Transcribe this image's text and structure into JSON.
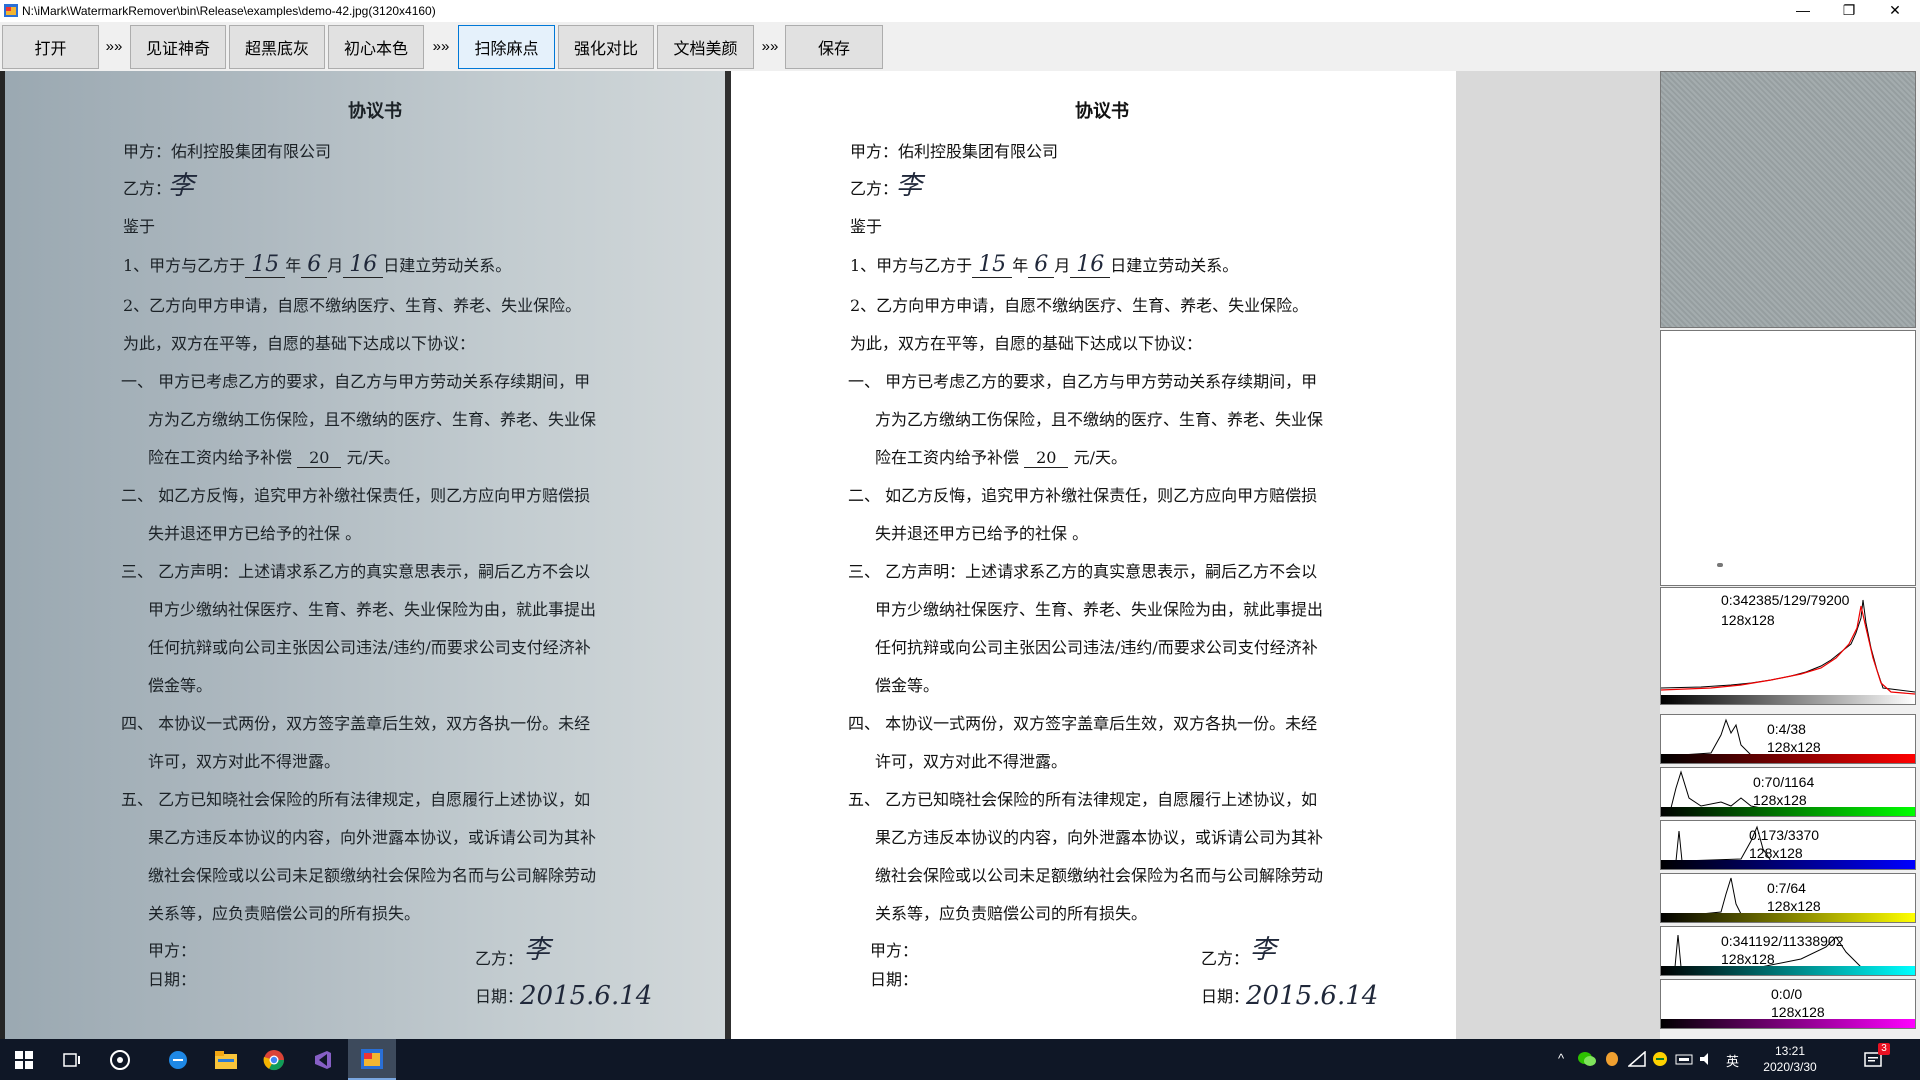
{
  "window": {
    "title": "N:\\iMark\\WatermarkRemover\\bin\\Release\\examples\\demo-42.jpg(3120x4160)",
    "minimize_glyph": "—",
    "restore_glyph": "❐",
    "close_glyph": "✕"
  },
  "toolbar": {
    "open": "打开",
    "sep1": "»»",
    "magic": "见证神奇",
    "black_gray": "超黑底灰",
    "original_color": "初心本色",
    "sep2": "»»",
    "remove_spots": "扫除麻点",
    "enhance_contrast": "强化对比",
    "doc_beautify": "文档美颜",
    "sep3": "»»",
    "save": "保存"
  },
  "document": {
    "title": "协议书",
    "party_a": "甲方：佑利控股集团有限公司",
    "party_b": "乙方：",
    "sig_li": "李",
    "whereas": "鉴于",
    "clause1_a": "1、甲方与乙方于",
    "clause1_y": "15",
    "clause1_b": "年",
    "clause1_m": "6",
    "clause1_c": "月",
    "clause1_d": "16",
    "clause1_e": "日建立劳动关系。",
    "clause2": "2、乙方向甲方申请，自愿不缴纳医疗、生育、养老、失业保险。",
    "therefore": "为此，双方在平等，自愿的基础下达成以下协议：",
    "item1_a": "一、    甲方已考虑乙方的要求，自乙方与甲方劳动关系存续期间，甲",
    "item1_b": "方为乙方缴纳工伤保险，且不缴纳的医疗、生育、养老、失业保",
    "item1_c": "险在工资内给予补偿",
    "item1_amount": "20",
    "item1_d": "元/天。",
    "item2_a": "二、    如乙方反悔，追究甲方补缴社保责任，则乙方应向甲方赔偿损",
    "item2_b": "失并退还甲方已给予的社保  。",
    "item3_a": "三、    乙方声明：上述请求系乙方的真实意思表示，嗣后乙方不会以",
    "item3_b": "甲方少缴纳社保医疗、生育、养老、失业保险为由，就此事提出",
    "item3_c": "任何抗辩或向公司主张因公司违法/违约/而要求公司支付经济补",
    "item3_d": "偿金等。",
    "item4_a": "四、    本协议一式两份，双方签字盖章后生效，双方各执一份。未经",
    "item4_b": "许可，双方对此不得泄露。",
    "item5_a": "五、    乙方已知晓社会保险的所有法律规定，自愿履行上述协议，如",
    "item5_b": "果乙方违反本协议的内容，向外泄露本协议，或诉请公司为其补",
    "item5_c": "缴社会保险或以公司未足额缴纳社会保险为名而与公司解除劳动",
    "item5_d": "关系等，应负责赔偿公司的所有损失。",
    "sign_a": "甲方：",
    "sign_b": "乙方：",
    "date_a": "日期：",
    "date_b": "日期：",
    "sig_date": "2015.6.14"
  },
  "histograms": {
    "main": {
      "line1": "0:342385/129/79200",
      "line2": "128x128"
    },
    "red": {
      "line1": "0:4/38",
      "line2": "128x128",
      "color": "#ff0000"
    },
    "green": {
      "line1": "0:70/1164",
      "line2": "128x128",
      "color": "#00ff00"
    },
    "blue": {
      "line1": "0:173/3370",
      "line2": "128x128",
      "color": "#0000ff"
    },
    "yellow": {
      "line1": "0:7/64",
      "line2": "128x128",
      "color": "#ffff00"
    },
    "cyan": {
      "line1": "0:341192/11338902",
      "line2": "128x128",
      "color": "#00ffff"
    },
    "magenta": {
      "line1": "0:0/0",
      "line2": "128x128",
      "color": "#ff00ff"
    }
  },
  "taskbar": {
    "start_icon": "windows-icon",
    "tray_lang": "英",
    "tray_chevron": "^",
    "notification_count": "3",
    "time": "13:21",
    "date": "2020/3/30"
  }
}
